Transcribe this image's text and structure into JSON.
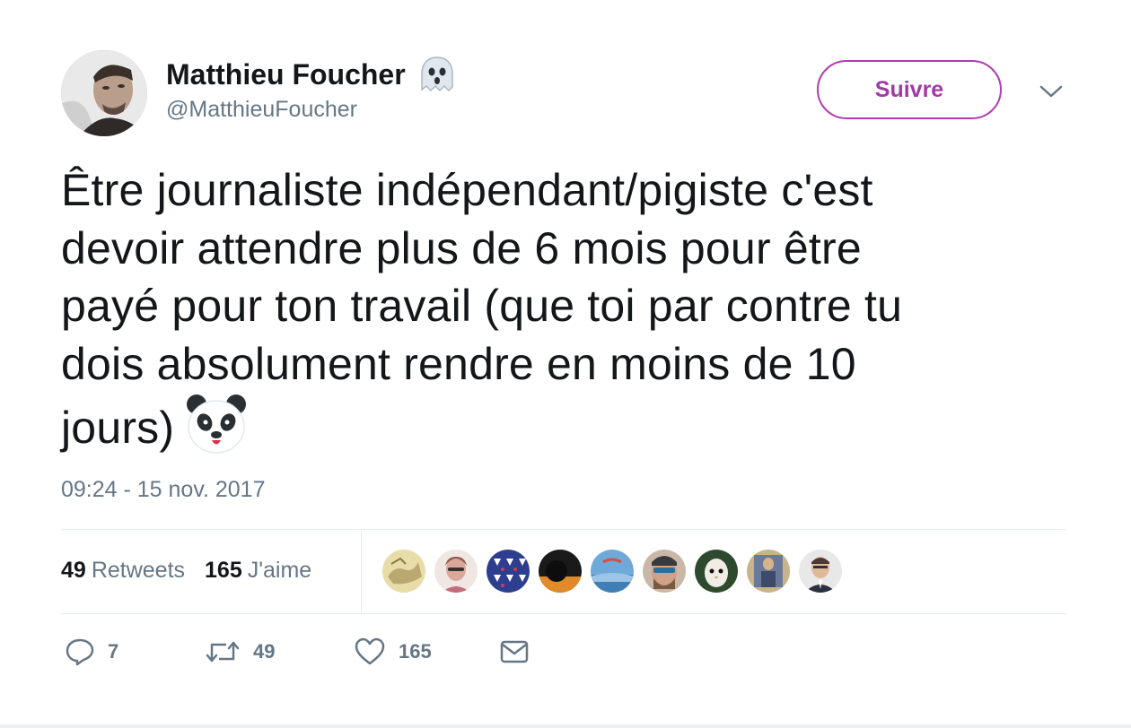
{
  "author": {
    "display_name": "Matthieu Foucher",
    "handle": "@MatthieuFoucher",
    "name_emoji": "ghost-icon"
  },
  "follow_button": {
    "label": "Suivre",
    "color": "#a23aa6"
  },
  "tweet": {
    "lines": [
      "Être journaliste indépendant/pigiste c'est",
      "devoir attendre plus de 6 mois pour être",
      "payé pour ton travail (que toi par contre tu",
      "dois absolument rendre en moins de 10",
      "jours)"
    ],
    "trailing_emoji": "panda-icon",
    "timestamp": "09:24 - 15 nov. 2017"
  },
  "stats": {
    "retweets_count": "49",
    "retweets_label": "Retweets",
    "likes_count": "165",
    "likes_label": "J'aime"
  },
  "likers": [
    "map",
    "woman",
    "pattern",
    "silhouette",
    "sunset",
    "man-beard",
    "owl",
    "painting",
    "man-suit"
  ],
  "actions": {
    "reply_count": "7",
    "retweet_count": "49",
    "like_count": "165"
  }
}
